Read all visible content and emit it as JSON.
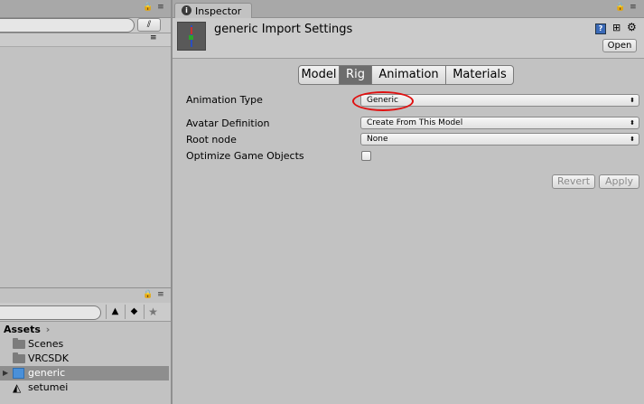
{
  "left_top": {
    "lock_menu": "🔒 ≡",
    "search_value": "",
    "sub_lock_menu": "≡"
  },
  "left_bottom": {
    "lock_menu": "🔒 ≡",
    "breadcrumb_root": "Assets",
    "breadcrumb_arrow": "›",
    "items": [
      {
        "label": "Scenes",
        "icon": "folder-icon"
      },
      {
        "label": "VRCSDK",
        "icon": "folder-icon"
      },
      {
        "label": "generic",
        "icon": "model-prefab-icon",
        "expand": "▶"
      },
      {
        "label": "setumei",
        "icon": "unity-scene-icon"
      }
    ]
  },
  "inspector": {
    "tab_label": "Inspector",
    "lock_menu": "🔒 ≡",
    "title": "generic Import Settings",
    "open_label": "Open",
    "tabs": [
      "Model",
      "Rig",
      "Animation",
      "Materials"
    ],
    "active_tab": "Rig",
    "fields": {
      "animation_type_label": "Animation Type",
      "animation_type_value": "Generic",
      "avatar_definition_label": "Avatar Definition",
      "avatar_definition_value": "Create From This Model",
      "root_node_label": "Root node",
      "root_node_value": "None",
      "optimize_label": "Optimize Game Objects"
    },
    "revert_label": "Revert",
    "apply_label": "Apply",
    "annotation_color": "#e01010"
  }
}
